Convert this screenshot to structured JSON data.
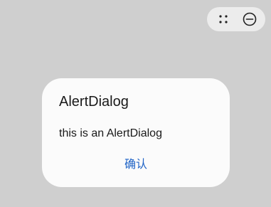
{
  "window_controls": {
    "drag_icon": "four-dots-icon",
    "minimize_icon": "minus-circle-icon"
  },
  "dialog": {
    "title": "AlertDialog",
    "message": "this is an AlertDialog",
    "confirm_label": "确认"
  },
  "colors": {
    "background": "#cfcfcf",
    "dialog_background": "#fbfbfb",
    "controls_background": "#ececec",
    "accent": "#1f63c6",
    "text": "#1a1a1a"
  }
}
